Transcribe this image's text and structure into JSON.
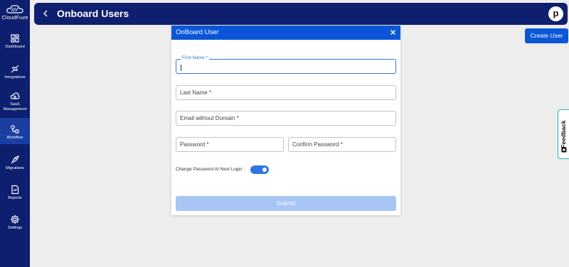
{
  "app": {
    "brand": "CloudFuze"
  },
  "sidebar": {
    "items": [
      {
        "label": "Dashboard",
        "icon": "dashboard-icon"
      },
      {
        "label": "Integrations",
        "icon": "integrations-icon"
      },
      {
        "label": "SaaS Management",
        "icon": "saas-management-icon"
      },
      {
        "label": "Workflow",
        "icon": "workflow-icon",
        "active": true
      },
      {
        "label": "Migrations",
        "icon": "rocket-icon"
      },
      {
        "label": "Reports",
        "icon": "reports-icon"
      },
      {
        "label": "Settings",
        "icon": "gear-icon"
      }
    ]
  },
  "header": {
    "title": "Onboard Users",
    "avatar_initial": "p"
  },
  "actions": {
    "create_user": "Create User"
  },
  "feedback": {
    "label": "Feedback"
  },
  "modal": {
    "title": "OnBoard User",
    "fields": {
      "first_name": {
        "label": "First Name *",
        "value": ""
      },
      "last_name": {
        "placeholder": "Last Name *"
      },
      "email": {
        "placeholder": "Email without Domain *"
      },
      "password": {
        "placeholder": "Password *"
      },
      "confirm_password": {
        "placeholder": "Confirm Password *"
      }
    },
    "toggle": {
      "label": "Change Password At Next Login :",
      "on": true
    },
    "submit": "Submit"
  },
  "colors": {
    "sidebar": "#0d1f6e",
    "accent": "#0a56d6",
    "submit_disabled": "#a8c6f5"
  }
}
